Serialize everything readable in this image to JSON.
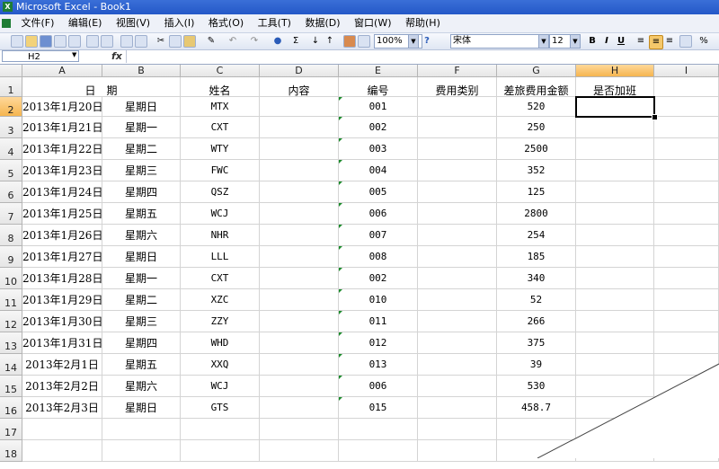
{
  "window": {
    "title": "Microsoft Excel - Book1",
    "app_icon": "excel-icon"
  },
  "menu": {
    "items": [
      "文件(F)",
      "编辑(E)",
      "视图(V)",
      "插入(I)",
      "格式(O)",
      "工具(T)",
      "数据(D)",
      "窗口(W)",
      "帮助(H)"
    ]
  },
  "toolbar": {
    "zoom": "100%",
    "font": "宋体",
    "font_size": "12",
    "bold": "B",
    "italic": "I",
    "underline": "U",
    "sigma": "Σ",
    "fx_help": "?"
  },
  "formula_bar": {
    "name_box": "H2",
    "fx_label": "fx",
    "content": ""
  },
  "sheet": {
    "columns": [
      "A",
      "B",
      "C",
      "D",
      "E",
      "F",
      "G",
      "H",
      "I"
    ],
    "active_column": "H",
    "active_row": "2",
    "selected_cell": "H2",
    "rows": [
      "1",
      "2",
      "3",
      "4",
      "5",
      "6",
      "7",
      "8",
      "9",
      "10",
      "11",
      "12",
      "13",
      "14",
      "15",
      "16",
      "17",
      "18"
    ],
    "header_row": {
      "date": "日　期",
      "name": "姓名",
      "content": "内容",
      "code": "编号",
      "category": "费用类别",
      "amount": "差旅费用金额",
      "overtime": "是否加班"
    },
    "data": [
      [
        "2013年1月20日",
        "星期日",
        "MTX",
        "",
        "001",
        "",
        "520",
        ""
      ],
      [
        "2013年1月21日",
        "星期一",
        "CXT",
        "",
        "002",
        "",
        "250",
        ""
      ],
      [
        "2013年1月22日",
        "星期二",
        "WTY",
        "",
        "003",
        "",
        "2500",
        ""
      ],
      [
        "2013年1月23日",
        "星期三",
        "FWC",
        "",
        "004",
        "",
        "352",
        ""
      ],
      [
        "2013年1月24日",
        "星期四",
        "QSZ",
        "",
        "005",
        "",
        "125",
        ""
      ],
      [
        "2013年1月25日",
        "星期五",
        "WCJ",
        "",
        "006",
        "",
        "2800",
        ""
      ],
      [
        "2013年1月26日",
        "星期六",
        "NHR",
        "",
        "007",
        "",
        "254",
        ""
      ],
      [
        "2013年1月27日",
        "星期日",
        "LLL",
        "",
        "008",
        "",
        "185",
        ""
      ],
      [
        "2013年1月28日",
        "星期一",
        "CXT",
        "",
        "002",
        "",
        "340",
        ""
      ],
      [
        "2013年1月29日",
        "星期二",
        "XZC",
        "",
        "010",
        "",
        "52",
        ""
      ],
      [
        "2013年1月30日",
        "星期三",
        "ZZY",
        "",
        "011",
        "",
        "266",
        ""
      ],
      [
        "2013年1月31日",
        "星期四",
        "WHD",
        "",
        "012",
        "",
        "375",
        ""
      ],
      [
        "2013年2月1日",
        "星期五",
        "XXQ",
        "",
        "013",
        "",
        "39",
        ""
      ],
      [
        "2013年2月2日",
        "星期六",
        "WCJ",
        "",
        "006",
        "",
        "530",
        ""
      ],
      [
        "2013年2月3日",
        "星期日",
        "GTS",
        "",
        "015",
        "",
        "458.7",
        ""
      ]
    ]
  },
  "colors": {
    "title_bar": "#2458c8",
    "active_header": "#f5b54f",
    "error_indicator": "#1a8a2a"
  }
}
